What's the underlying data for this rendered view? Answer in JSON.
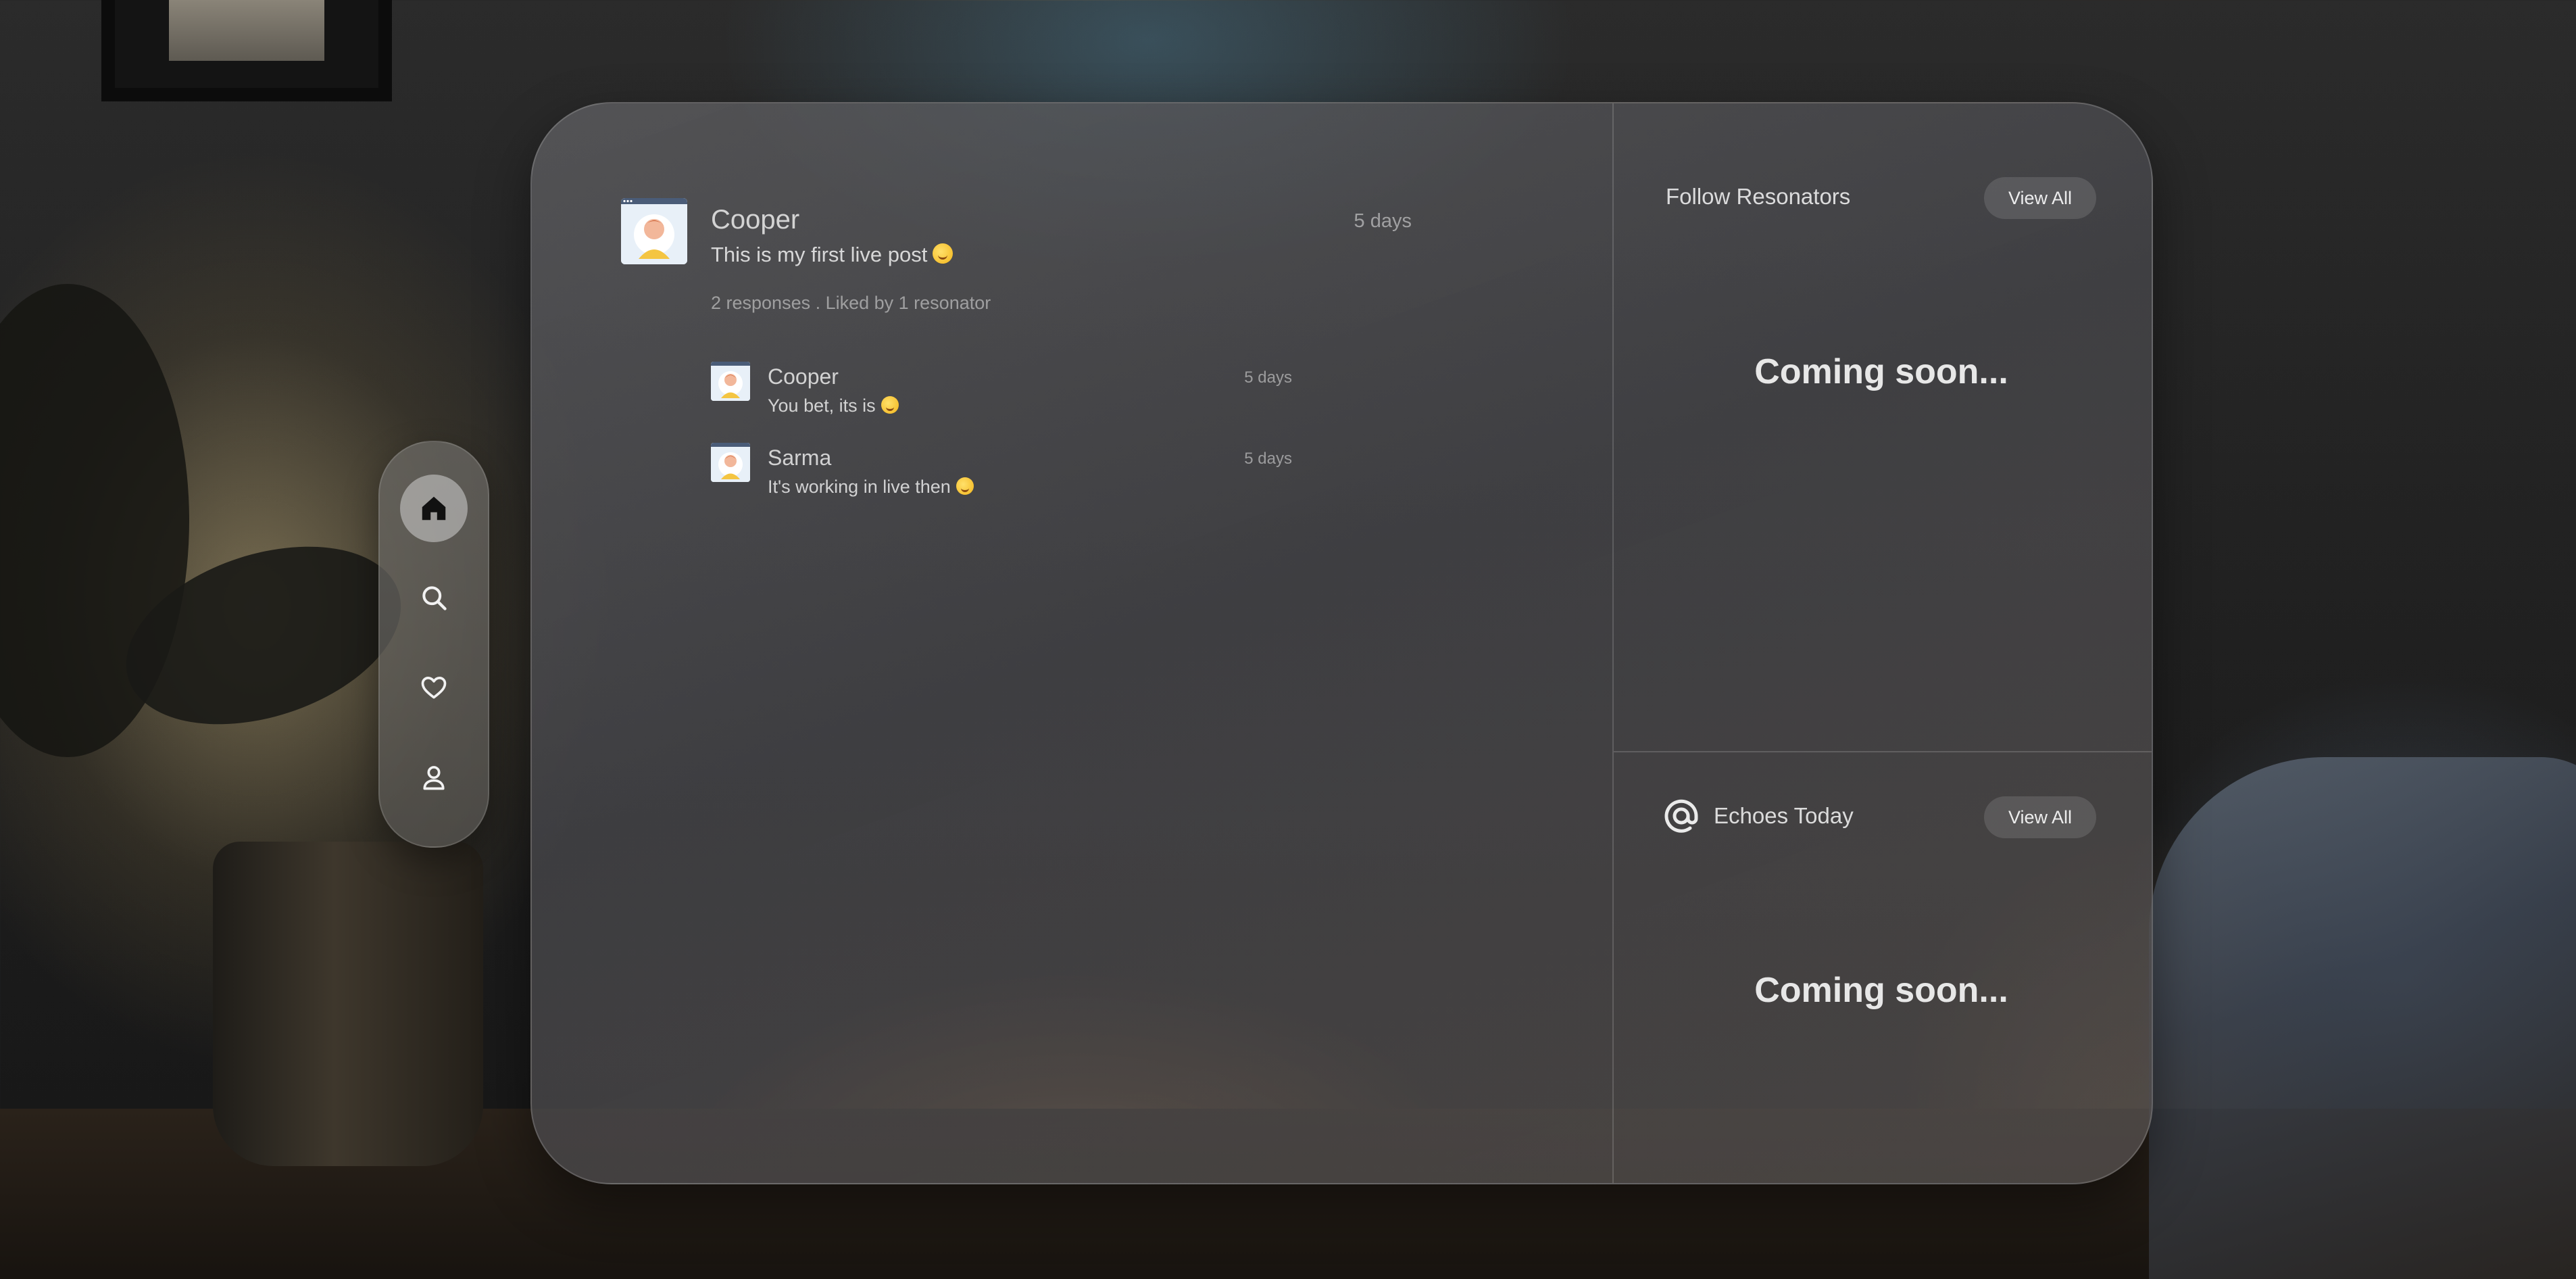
{
  "feed": {
    "post": {
      "author": "Cooper",
      "time": "5 days",
      "text": "This is my first live post",
      "meta": "2 responses . Liked by 1 resonator"
    },
    "replies": [
      {
        "author": "Cooper",
        "time": "5 days",
        "text": "You bet, its is"
      },
      {
        "author": "Sarma",
        "time": "5 days",
        "text": "It's working in live then"
      }
    ]
  },
  "follow_resonators": {
    "title": "Follow Resonators",
    "view_all": "View All",
    "placeholder": "Coming soon..."
  },
  "echoes_today": {
    "title": "Echoes Today",
    "view_all": "View All",
    "placeholder": "Coming soon..."
  },
  "nav": {
    "items": [
      {
        "icon": "home-icon",
        "active": true
      },
      {
        "icon": "search-icon",
        "active": false
      },
      {
        "icon": "heart-icon",
        "active": false
      },
      {
        "icon": "profile-icon",
        "active": false
      }
    ]
  },
  "colors": {
    "panel": "#5a5a5e",
    "accent_text": "#f0f0f0",
    "muted_text": "#b8b8b8"
  }
}
